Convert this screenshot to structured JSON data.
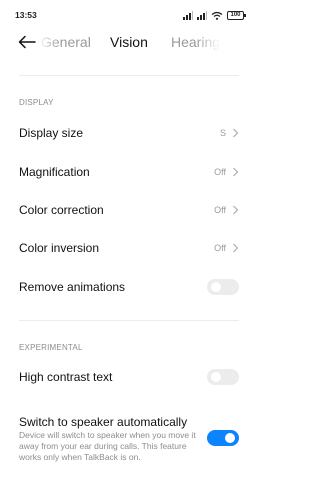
{
  "status_bar": {
    "time": "13:53",
    "battery": "100",
    "icons": [
      "signal-icon",
      "signal-icon",
      "wifi-icon",
      "battery-icon"
    ]
  },
  "nav": {
    "back_icon": "back-arrow-icon",
    "tabs": [
      {
        "label": "General",
        "active": false
      },
      {
        "label": "Vision",
        "active": true
      },
      {
        "label": "Hearing",
        "active": false
      }
    ]
  },
  "sections": {
    "display": {
      "header": "DISPLAY",
      "items": [
        {
          "label": "Display size",
          "value": "S",
          "type": "chevron"
        },
        {
          "label": "Magnification",
          "value": "Off",
          "type": "chevron"
        },
        {
          "label": "Color correction",
          "value": "Off",
          "type": "chevron"
        },
        {
          "label": "Color inversion",
          "value": "Off",
          "type": "chevron"
        },
        {
          "label": "Remove animations",
          "toggle": false,
          "type": "toggle"
        }
      ]
    },
    "experimental": {
      "header": "EXPERIMENTAL",
      "items": [
        {
          "label": "High contrast text",
          "toggle": false,
          "type": "toggle"
        },
        {
          "label": "Switch to speaker automatically",
          "description": "Device will switch to speaker when you move it away from your ear during calls. This feature works only when TalkBack is on.",
          "toggle": true,
          "type": "toggle"
        }
      ]
    }
  },
  "colors": {
    "accent": "#0d84ff",
    "toggle_off": "#ececec",
    "secondary_text": "#8d8d8d"
  }
}
